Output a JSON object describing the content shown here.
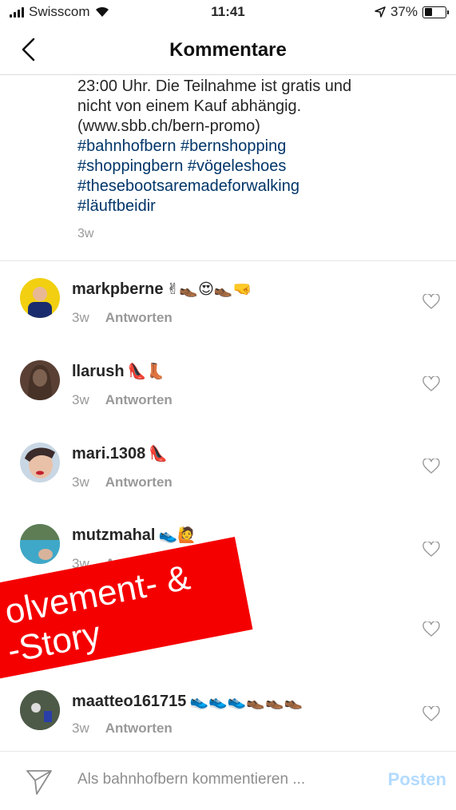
{
  "status_bar": {
    "carrier": "Swisscom",
    "time": "11:41",
    "battery": "37%",
    "battery_level": 0.37
  },
  "header": {
    "title": "Kommentare"
  },
  "caption": {
    "lines": [
      "23:00 Uhr. Die Teilnahme ist gratis und",
      "nicht von einem Kauf abhängig.",
      "(www.sbb.ch/bern-promo)"
    ],
    "hashtags": [
      "#bahnhofbern #bernshopping",
      "#shoppingbern #vögeleshoes",
      "#thesebootsaremadeforwalking",
      "#läuftbeidir"
    ],
    "time": "3w"
  },
  "comments": [
    {
      "username": "markpberne",
      "emoji": "✌👞😍👞🤜",
      "time": "3w",
      "reply": "Antworten"
    },
    {
      "username": "llarush",
      "emoji": "👠👢",
      "time": "3w",
      "reply": "Antworten"
    },
    {
      "username": "mari.1308",
      "emoji": "👠",
      "time": "3w",
      "reply": "Antworten"
    },
    {
      "username": "mutzmahal",
      "emoji": "👟🙋",
      "time": "3w",
      "reply": "Antw"
    },
    {
      "username": "maatteo161715",
      "emoji": "👟👟👟👞👞👞",
      "time": "3w",
      "reply": "Antworten"
    }
  ],
  "overlay": {
    "line1": "olvement- &",
    "line2": "-Story"
  },
  "composer": {
    "placeholder": "Als bahnhofbern kommentieren ...",
    "post_label": "Posten"
  },
  "colors": {
    "hashtag": "#003569",
    "meta": "#999999",
    "post_button": "#b3dbff",
    "overlay": "#f50000"
  }
}
